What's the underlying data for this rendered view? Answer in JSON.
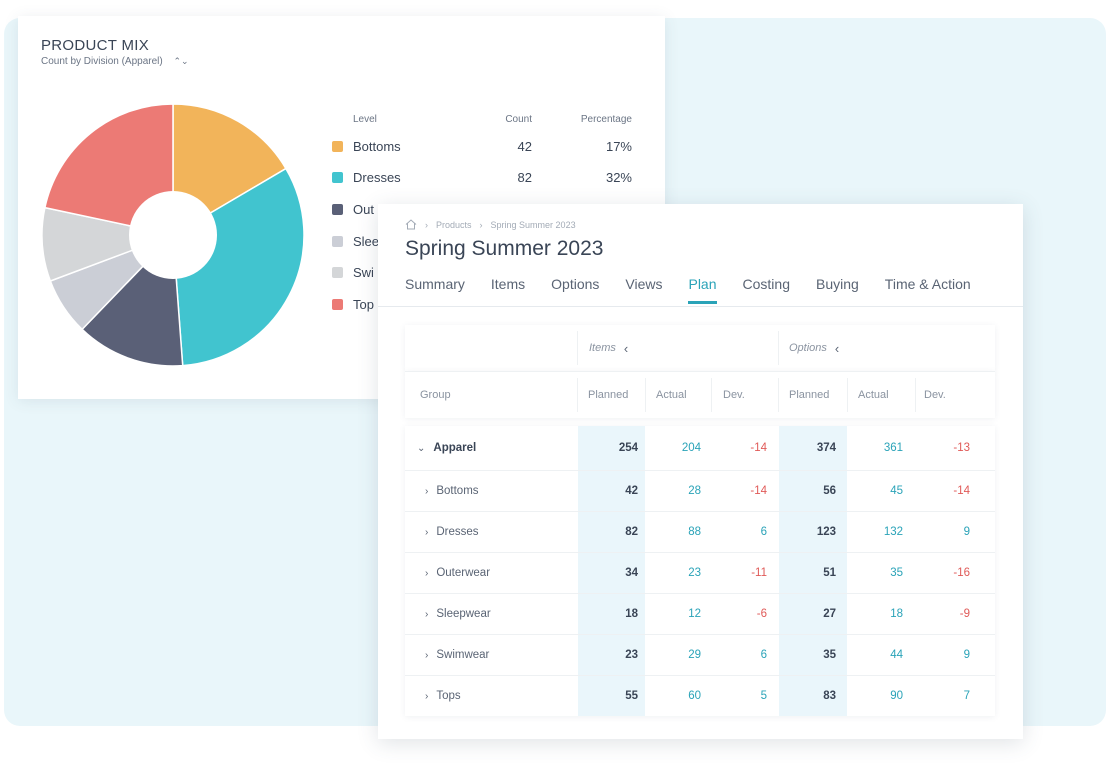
{
  "product_mix": {
    "title": "PRODUCT MIX",
    "subtitle": "Count by Division (Apparel)",
    "legend_headers": {
      "level": "Level",
      "count": "Count",
      "percentage": "Percentage"
    },
    "legend": [
      {
        "name": "Bottoms",
        "count": "42",
        "percentage": "17%",
        "color": "#f2b45a"
      },
      {
        "name": "Dresses",
        "count": "82",
        "percentage": "32%",
        "color": "#41c4cf"
      },
      {
        "name": "Out",
        "color": "#5a6077"
      },
      {
        "name": "Slee",
        "color": "#cbced6"
      },
      {
        "name": "Swi",
        "color": "#d4d6d8"
      },
      {
        "name": "Top",
        "color": "#ec7a75"
      }
    ]
  },
  "chart_data": {
    "type": "pie",
    "title": "PRODUCT MIX",
    "subtitle": "Count by Division (Apparel)",
    "categories": [
      "Bottoms",
      "Dresses",
      "Outerwear",
      "Sleepwear",
      "Swimwear",
      "Tops"
    ],
    "values": [
      42,
      82,
      34,
      18,
      23,
      55
    ],
    "colors": [
      "#f2b45a",
      "#41c4cf",
      "#5a6077",
      "#cbced6",
      "#d4d6d8",
      "#ec7a75"
    ],
    "donut": true
  },
  "plan": {
    "breadcrumb": [
      "Products",
      "Spring Summer 2023"
    ],
    "title": "Spring Summer 2023",
    "tabs": [
      "Summary",
      "Items",
      "Options",
      "Views",
      "Plan",
      "Costing",
      "Buying",
      "Time & Action"
    ],
    "active_tab": "Plan",
    "group_headers": {
      "items": "Items",
      "options": "Options"
    },
    "columns": {
      "group": "Group",
      "planned": "Planned",
      "actual": "Actual",
      "dev": "Dev."
    },
    "rows": [
      {
        "name": "Apparel",
        "top": true,
        "items": [
          "254",
          "204",
          "-14"
        ],
        "options": [
          "374",
          "361",
          "-13"
        ]
      },
      {
        "name": "Bottoms",
        "items": [
          "42",
          "28",
          "-14"
        ],
        "options": [
          "56",
          "45",
          "-14"
        ]
      },
      {
        "name": "Dresses",
        "items": [
          "82",
          "88",
          "6"
        ],
        "options": [
          "123",
          "132",
          "9"
        ]
      },
      {
        "name": "Outerwear",
        "items": [
          "34",
          "23",
          "-11"
        ],
        "options": [
          "51",
          "35",
          "-16"
        ]
      },
      {
        "name": "Sleepwear",
        "items": [
          "18",
          "12",
          "-6"
        ],
        "options": [
          "27",
          "18",
          "-9"
        ]
      },
      {
        "name": "Swimwear",
        "items": [
          "23",
          "29",
          "6"
        ],
        "options": [
          "35",
          "44",
          "9"
        ]
      },
      {
        "name": "Tops",
        "items": [
          "55",
          "60",
          "5"
        ],
        "options": [
          "83",
          "90",
          "7"
        ]
      }
    ]
  }
}
